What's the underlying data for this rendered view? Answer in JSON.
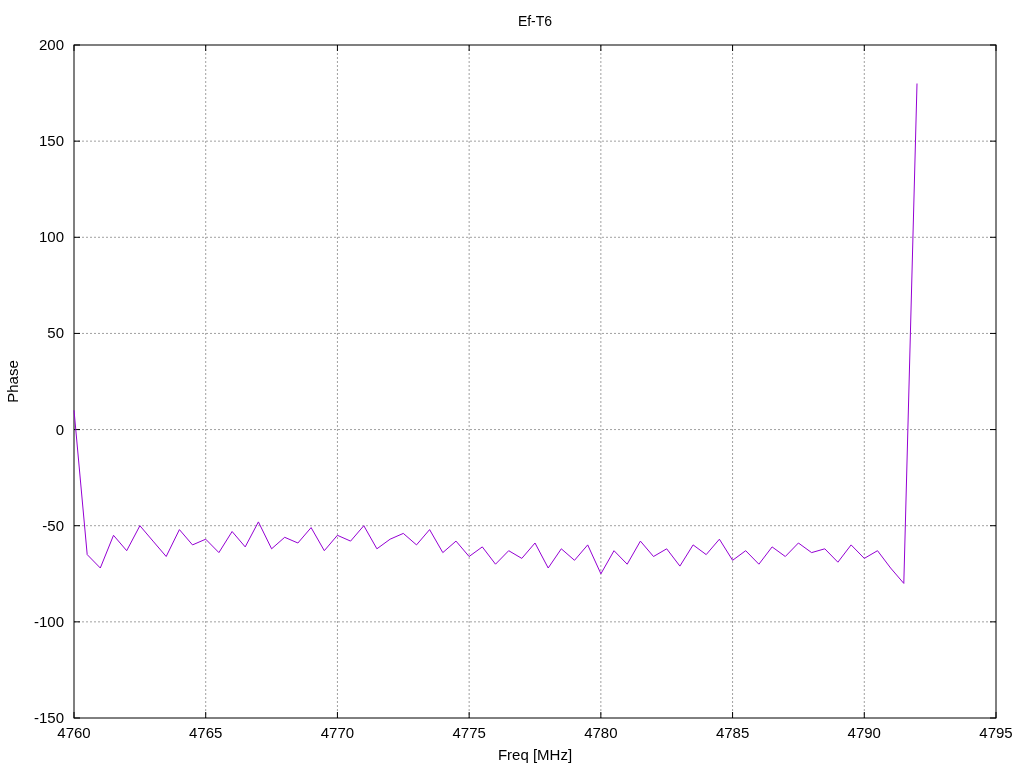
{
  "chart": {
    "chart_data": {
      "type": "line",
      "grid": true,
      "title": "Ef-T6",
      "xlabel": "Freq [MHz]",
      "ylabel": "Phase",
      "xlim": [
        4760,
        4795
      ],
      "ylim": [
        -150,
        200
      ],
      "xticks": [
        4760,
        4765,
        4770,
        4775,
        4780,
        4785,
        4790,
        4795
      ],
      "yticks": [
        -150,
        -100,
        -50,
        0,
        50,
        100,
        150,
        200
      ],
      "x": [
        4760,
        4760.5,
        4761,
        4761.5,
        4762,
        4762.5,
        4763,
        4763.5,
        4764,
        4764.5,
        4765,
        4765.5,
        4766,
        4766.5,
        4767,
        4767.5,
        4768,
        4768.5,
        4769,
        4769.5,
        4770,
        4770.5,
        4771,
        4771.5,
        4772,
        4772.5,
        4773,
        4773.5,
        4774,
        4774.5,
        4775,
        4775.5,
        4776,
        4776.5,
        4777,
        4777.5,
        4778,
        4778.5,
        4779,
        4779.5,
        4780,
        4780.5,
        4781,
        4781.5,
        4782,
        4782.5,
        4783,
        4783.5,
        4784,
        4784.5,
        4785,
        4785.5,
        4786,
        4786.5,
        4787,
        4787.5,
        4788,
        4788.5,
        4789,
        4789.5,
        4790,
        4790.5,
        4791,
        4791.5,
        4792
      ],
      "series": [
        {
          "color": "#9400d3",
          "values": [
            10,
            -65,
            -72,
            -55,
            -63,
            -50,
            -58,
            -66,
            -52,
            -60,
            -57,
            -64,
            -53,
            -61,
            -48,
            -62,
            -56,
            -59,
            -51,
            -63,
            -55,
            -58,
            -50,
            -62,
            -57,
            -54,
            -60,
            -52,
            -64,
            -58,
            -66,
            -61,
            -70,
            -63,
            -67,
            -59,
            -72,
            -62,
            -68,
            -60,
            -75,
            -63,
            -70,
            -58,
            -66,
            -62,
            -71,
            -60,
            -65,
            -57,
            -68,
            -63,
            -70,
            -61,
            -66,
            -59,
            -64,
            -62,
            -69,
            -60,
            -67,
            -63,
            -72,
            -80,
            180
          ]
        }
      ]
    }
  }
}
